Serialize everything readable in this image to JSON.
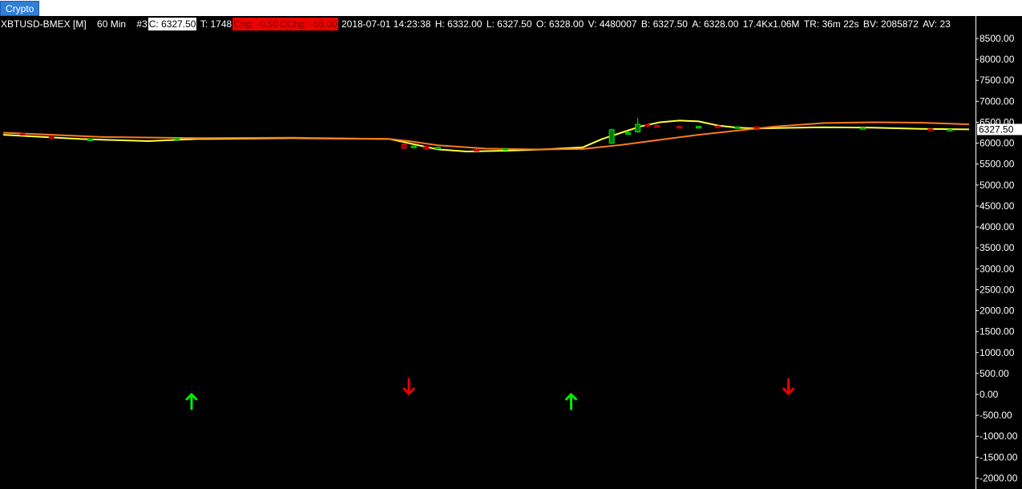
{
  "tab": {
    "label": "Crypto"
  },
  "infobar": {
    "symbol": "XBTUSD-BMEX [M]",
    "interval": "60 Min",
    "index": "#3",
    "close": "C: 6327.50",
    "ticks": "T: 1748",
    "chg": "Chg: -0.50",
    "dchg": "DChg: -56.00",
    "datetime": "2018-07-01 14:23:38",
    "high": "H: 6332.00",
    "low": "L: 6327.50",
    "open": "O: 6328.00",
    "volume": "V: 4480007",
    "bid": "B: 6327.50",
    "ask": "A: 6328.00",
    "size": "17.4Kx1.06M",
    "time_remaining": "TR: 36m 22s",
    "bid_volume": "BV: 2085872",
    "ask_volume": "AV: 23"
  },
  "colors": {
    "up": "#00ee00",
    "down": "#ee0000",
    "ma_fast": "#ffff40",
    "ma_slow": "#ff7a1a",
    "background": "#000000",
    "last_price_label_bg": "#ffffff"
  },
  "chart_data": {
    "type": "line",
    "y_axis": {
      "min": -2000,
      "max": 8500,
      "step": 500,
      "tick_labels": [
        "8500.00",
        "8000.00",
        "7500.00",
        "7000.00",
        "6500.00",
        "6000.00",
        "5500.00",
        "5000.00",
        "4500.00",
        "4000.00",
        "3500.00",
        "3000.00",
        "2500.00",
        "2000.00",
        "1500.00",
        "1000.00",
        "500.00",
        "0.00",
        "-500.00",
        "-1000.00",
        "-1500.00",
        "-2000.00"
      ]
    },
    "last_price": "6327.50",
    "x_range": [
      0,
      100
    ],
    "series": [
      {
        "key": "fast",
        "color": "#ffff40",
        "x": [
          0,
          8,
          15,
          20,
          30,
          40,
          42,
          45,
          48,
          52,
          56,
          60,
          62,
          64,
          66,
          68,
          70,
          72,
          74,
          76,
          78,
          80,
          85,
          90,
          95,
          100
        ],
        "y": [
          6200,
          6100,
          6050,
          6100,
          6120,
          6100,
          6000,
          5850,
          5800,
          5820,
          5850,
          5900,
          6100,
          6250,
          6400,
          6500,
          6540,
          6520,
          6420,
          6370,
          6350,
          6360,
          6380,
          6370,
          6340,
          6330
        ]
      },
      {
        "key": "slow",
        "color": "#ff7a1a",
        "x": [
          0,
          10,
          20,
          30,
          40,
          42,
          45,
          50,
          55,
          60,
          64,
          68,
          72,
          76,
          80,
          85,
          90,
          95,
          100
        ],
        "y": [
          6250,
          6150,
          6120,
          6130,
          6100,
          6050,
          5950,
          5870,
          5850,
          5860,
          5960,
          6080,
          6200,
          6300,
          6400,
          6480,
          6500,
          6490,
          6450
        ]
      }
    ],
    "candles": [
      {
        "x": 2,
        "o": 6230,
        "c": 6220,
        "h": 6250,
        "l": 6200
      },
      {
        "x": 5,
        "o": 6150,
        "c": 6140,
        "h": 6170,
        "l": 6120
      },
      {
        "x": 9,
        "o": 6080,
        "c": 6100,
        "h": 6110,
        "l": 6070
      },
      {
        "x": 18,
        "o": 6100,
        "c": 6120,
        "h": 6130,
        "l": 6090
      },
      {
        "x": 41.5,
        "o": 5970,
        "c": 5880,
        "h": 5990,
        "l": 5860
      },
      {
        "x": 42.5,
        "o": 5900,
        "c": 5930,
        "h": 5940,
        "l": 5880
      },
      {
        "x": 43.8,
        "o": 5920,
        "c": 5860,
        "h": 5930,
        "l": 5840
      },
      {
        "x": 45,
        "o": 5860,
        "c": 5900,
        "h": 5910,
        "l": 5850
      },
      {
        "x": 49,
        "o": 5850,
        "c": 5830,
        "h": 5870,
        "l": 5810
      },
      {
        "x": 52,
        "o": 5860,
        "c": 5870,
        "h": 5880,
        "l": 5850
      },
      {
        "x": 63,
        "o": 6000,
        "c": 6320,
        "h": 6350,
        "l": 5980
      },
      {
        "x": 64.7,
        "o": 6230,
        "c": 6250,
        "h": 6280,
        "l": 6220
      },
      {
        "x": 65.7,
        "o": 6270,
        "c": 6450,
        "h": 6600,
        "l": 6250
      },
      {
        "x": 66.7,
        "o": 6440,
        "c": 6410,
        "h": 6460,
        "l": 6390
      },
      {
        "x": 67.7,
        "o": 6420,
        "c": 6400,
        "h": 6440,
        "l": 6380
      },
      {
        "x": 70,
        "o": 6400,
        "c": 6390,
        "h": 6420,
        "l": 6380
      },
      {
        "x": 72,
        "o": 6390,
        "c": 6400,
        "h": 6410,
        "l": 6370
      },
      {
        "x": 74,
        "o": 6410,
        "c": 6390,
        "h": 6420,
        "l": 6380
      },
      {
        "x": 76,
        "o": 6380,
        "c": 6390,
        "h": 6400,
        "l": 6370
      },
      {
        "x": 78,
        "o": 6390,
        "c": 6370,
        "h": 6400,
        "l": 6360
      },
      {
        "x": 89,
        "o": 6360,
        "c": 6370,
        "h": 6380,
        "l": 6350
      },
      {
        "x": 96,
        "o": 6340,
        "c": 6320,
        "h": 6350,
        "l": 6310
      },
      {
        "x": 98,
        "o": 6320,
        "c": 6330,
        "h": 6340,
        "l": 6310
      }
    ],
    "signals": [
      {
        "x": 19.5,
        "direction": "up"
      },
      {
        "x": 42,
        "direction": "down"
      },
      {
        "x": 58.8,
        "direction": "up"
      },
      {
        "x": 81.3,
        "direction": "down"
      }
    ]
  }
}
